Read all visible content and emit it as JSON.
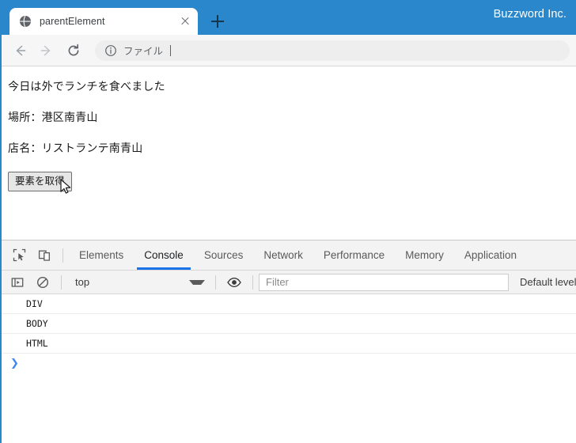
{
  "browser": {
    "brand": "Buzzword Inc.",
    "tab": {
      "title": "parentElement",
      "favicon_icon": "globe-icon",
      "close_icon": "close-icon"
    },
    "new_tab_icon": "plus-icon",
    "toolbar": {
      "back_icon": "arrow-left-icon",
      "forward_icon": "arrow-right-icon",
      "reload_icon": "reload-icon",
      "omnibox_icon": "info-circle-icon",
      "omnibox_text": "ファイル"
    }
  },
  "page": {
    "lines": [
      "今日は外でランチを食べました",
      "場所：港区南青山",
      "店名：リストランテ南青山"
    ],
    "button_label": "要素を取得",
    "cursor_icon": "mouse-pointer-icon"
  },
  "devtools": {
    "inspect_icon": "inspect-element-icon",
    "device_toolbar_icon": "device-toggle-icon",
    "tabs": [
      {
        "label": "Elements",
        "active": false
      },
      {
        "label": "Console",
        "active": true
      },
      {
        "label": "Sources",
        "active": false
      },
      {
        "label": "Network",
        "active": false
      },
      {
        "label": "Performance",
        "active": false
      },
      {
        "label": "Memory",
        "active": false
      },
      {
        "label": "Application",
        "active": false
      }
    ],
    "filterbar": {
      "sidebar_icon": "console-sidebar-icon",
      "clear_icon": "clear-console-icon",
      "context": "top",
      "context_arrow_icon": "chevron-down-icon",
      "eye_icon": "live-expression-eye-icon",
      "filter_placeholder": "Filter",
      "filter_value": "",
      "levels": "Default levels"
    },
    "console_messages": [
      "DIV",
      "BODY",
      "HTML"
    ],
    "prompt_arrow": "❯"
  },
  "colors": {
    "brand_blue": "#2a87cc",
    "tab_underline": "#1a73e8",
    "prompt_blue": "#4285f4"
  }
}
